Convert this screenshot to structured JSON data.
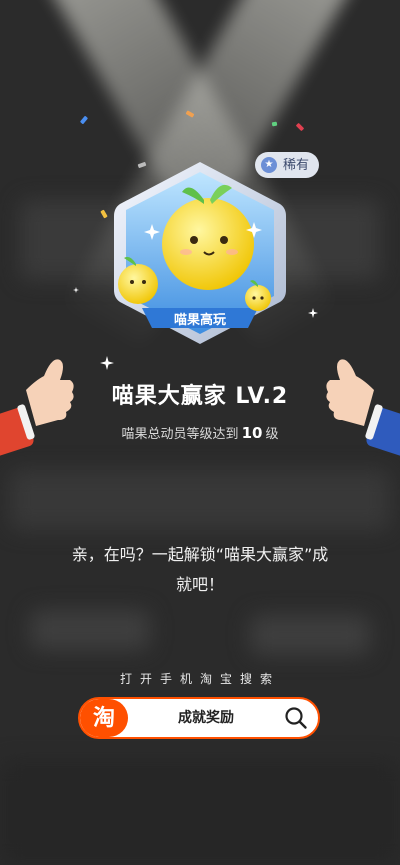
{
  "badge": {
    "image_text": "喵果高玩",
    "rarity": "稀有",
    "rarity_icon": "star-badge-icon"
  },
  "achievement": {
    "title": "喵果大赢家 LV.2",
    "subtitle_prefix": "喵果总动员等级达到",
    "level": "10",
    "subtitle_suffix": "级"
  },
  "invite_text": "亲，在吗？一起解锁“喵果大赢家”成就吧！",
  "search": {
    "hint": "打开手机淘宝搜索",
    "app_logo": "淘",
    "query": "成就奖励",
    "icon": "search-icon"
  },
  "colors": {
    "taobao_orange": "#ff5000",
    "badge_blue": "#4a9be8",
    "background": "#2b2b2b"
  }
}
